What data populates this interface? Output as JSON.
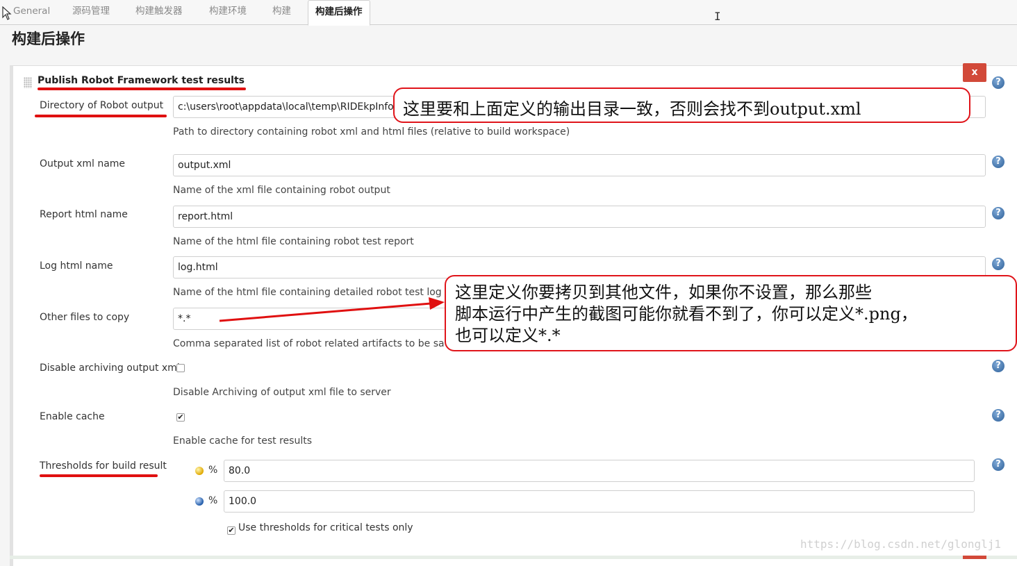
{
  "tabs": [
    {
      "label": "General"
    },
    {
      "label": "源码管理"
    },
    {
      "label": "构建触发器"
    },
    {
      "label": "构建环境"
    },
    {
      "label": "构建"
    },
    {
      "label": "构建后操作",
      "active": true
    }
  ],
  "page_title": "构建后操作",
  "section": {
    "title": "Publish Robot Framework test results",
    "delete_label": "x",
    "help_label": "?"
  },
  "fields": {
    "directory": {
      "label": "Directory of Robot output",
      "value": "c:\\users\\root\\appdata\\local\\temp\\RIDEkpInfo.d",
      "description": "Path to directory containing robot xml and html files (relative to build workspace)"
    },
    "output_xml": {
      "label": "Output xml name",
      "value": "output.xml",
      "description": "Name of the xml file containing robot output"
    },
    "report_html": {
      "label": "Report html name",
      "value": "report.html",
      "description": "Name of the html file containing robot test report"
    },
    "log_html": {
      "label": "Log html name",
      "value": "log.html",
      "description": "Name of the html file containing detailed robot test log"
    },
    "other_files": {
      "label": "Other files to copy",
      "value": "*.*",
      "description": "Comma separated list of robot related artifacts to be saved"
    },
    "disable_archiving": {
      "label": "Disable archiving output xml",
      "checked": false,
      "description": "Disable Archiving of output xml file to server"
    },
    "enable_cache": {
      "label": "Enable cache",
      "checked": true,
      "description": "Enable cache for test results"
    },
    "thresholds": {
      "label": "Thresholds for build result",
      "unstable_symbol": "%",
      "unstable_value": "80.0",
      "pass_symbol": "%",
      "pass_value": "100.0",
      "critical_only_label": "Use thresholds for critical tests only",
      "critical_only_checked": true
    }
  },
  "annotations": {
    "callout1": "这里要和上面定义的输出目录一致，否则会找不到output.xml",
    "callout2_lines": [
      "这里定义你要拷贝到其他文件，如果你不设置，那么那些",
      "脚本运行中产生的截图可能你就看不到了，你可以定义*.png，",
      "也可以定义*.*"
    ],
    "annotation_color": "#e01010"
  },
  "watermark": "https://blog.csdn.net/glonglj1",
  "colors": {
    "delete_button": "#d24939",
    "help_icon": "#2c5f99"
  }
}
